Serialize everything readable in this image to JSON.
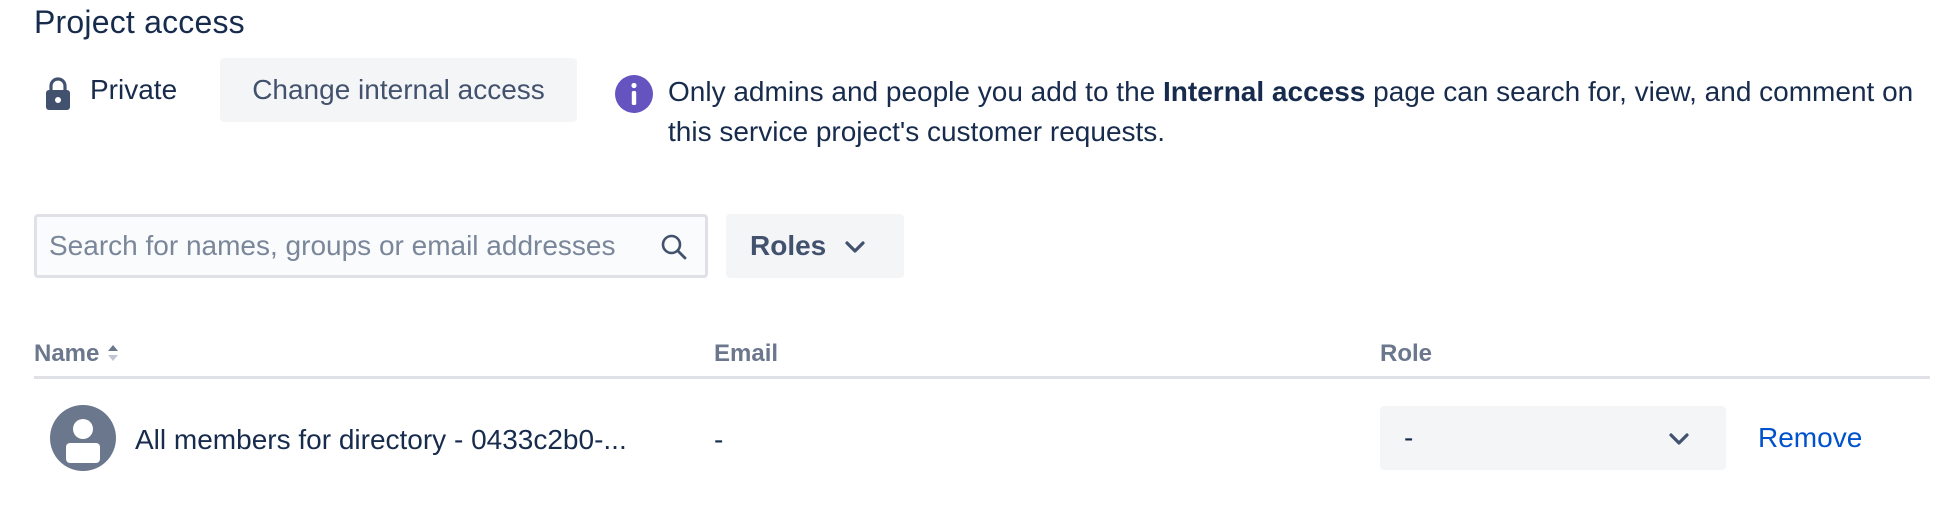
{
  "page": {
    "title": "Project access"
  },
  "access": {
    "lock_icon": "lock-icon",
    "private_label": "Private",
    "change_button_label": "Change internal access",
    "info_icon": "info-icon",
    "info_text_before": "Only admins and people you add to the ",
    "info_text_bold": "Internal access",
    "info_text_after": " page can search for, view, and comment on this service project's customer requests."
  },
  "search": {
    "placeholder": "Search for names, groups or email addresses",
    "value": "",
    "icon": "search-icon"
  },
  "filters": {
    "roles_label": "Roles",
    "roles_icon": "chevron-down-icon"
  },
  "table": {
    "columns": [
      "Name",
      "Email",
      "Role"
    ],
    "sort_icon": "sort-ascending-icon",
    "rows": [
      {
        "avatar_icon": "user-avatar-icon",
        "name": "All members for directory - 0433c2b0-...",
        "email": "-",
        "role": "-",
        "action": "Remove"
      }
    ]
  },
  "colors": {
    "text_primary": "#172B4D",
    "text_secondary": "#42526E",
    "header_text": "#6B778C",
    "link": "#0052CC",
    "info_purple": "#6554C0",
    "button_bg": "#F4F5F7",
    "border": "#DFE1E6"
  }
}
